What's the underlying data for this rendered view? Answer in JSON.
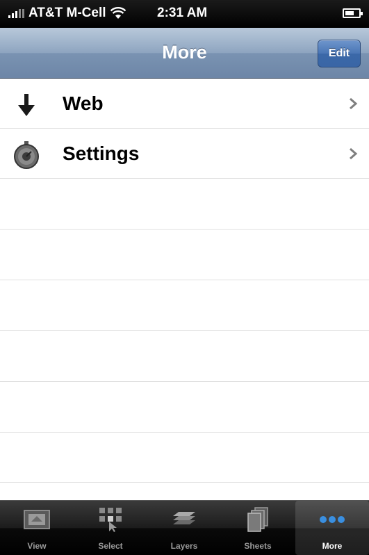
{
  "status_bar": {
    "carrier": "AT&T M-Cell",
    "time": "2:31 AM"
  },
  "nav_bar": {
    "title": "More",
    "edit_label": "Edit"
  },
  "list": {
    "items": [
      {
        "label": "Web",
        "icon": "download-arrow-icon"
      },
      {
        "label": "Settings",
        "icon": "settings-dial-icon"
      }
    ]
  },
  "tab_bar": {
    "selected": "More",
    "tabs": [
      {
        "label": "View",
        "icon": "view-icon"
      },
      {
        "label": "Select",
        "icon": "select-grid-icon"
      },
      {
        "label": "Layers",
        "icon": "layers-icon"
      },
      {
        "label": "Sheets",
        "icon": "sheets-icon"
      },
      {
        "label": "More",
        "icon": "more-dots-icon"
      }
    ]
  },
  "colors": {
    "nav_blue": "#7a93b2",
    "edit_button_blue": "#4a76b5",
    "tab_bar_black": "#000000"
  }
}
